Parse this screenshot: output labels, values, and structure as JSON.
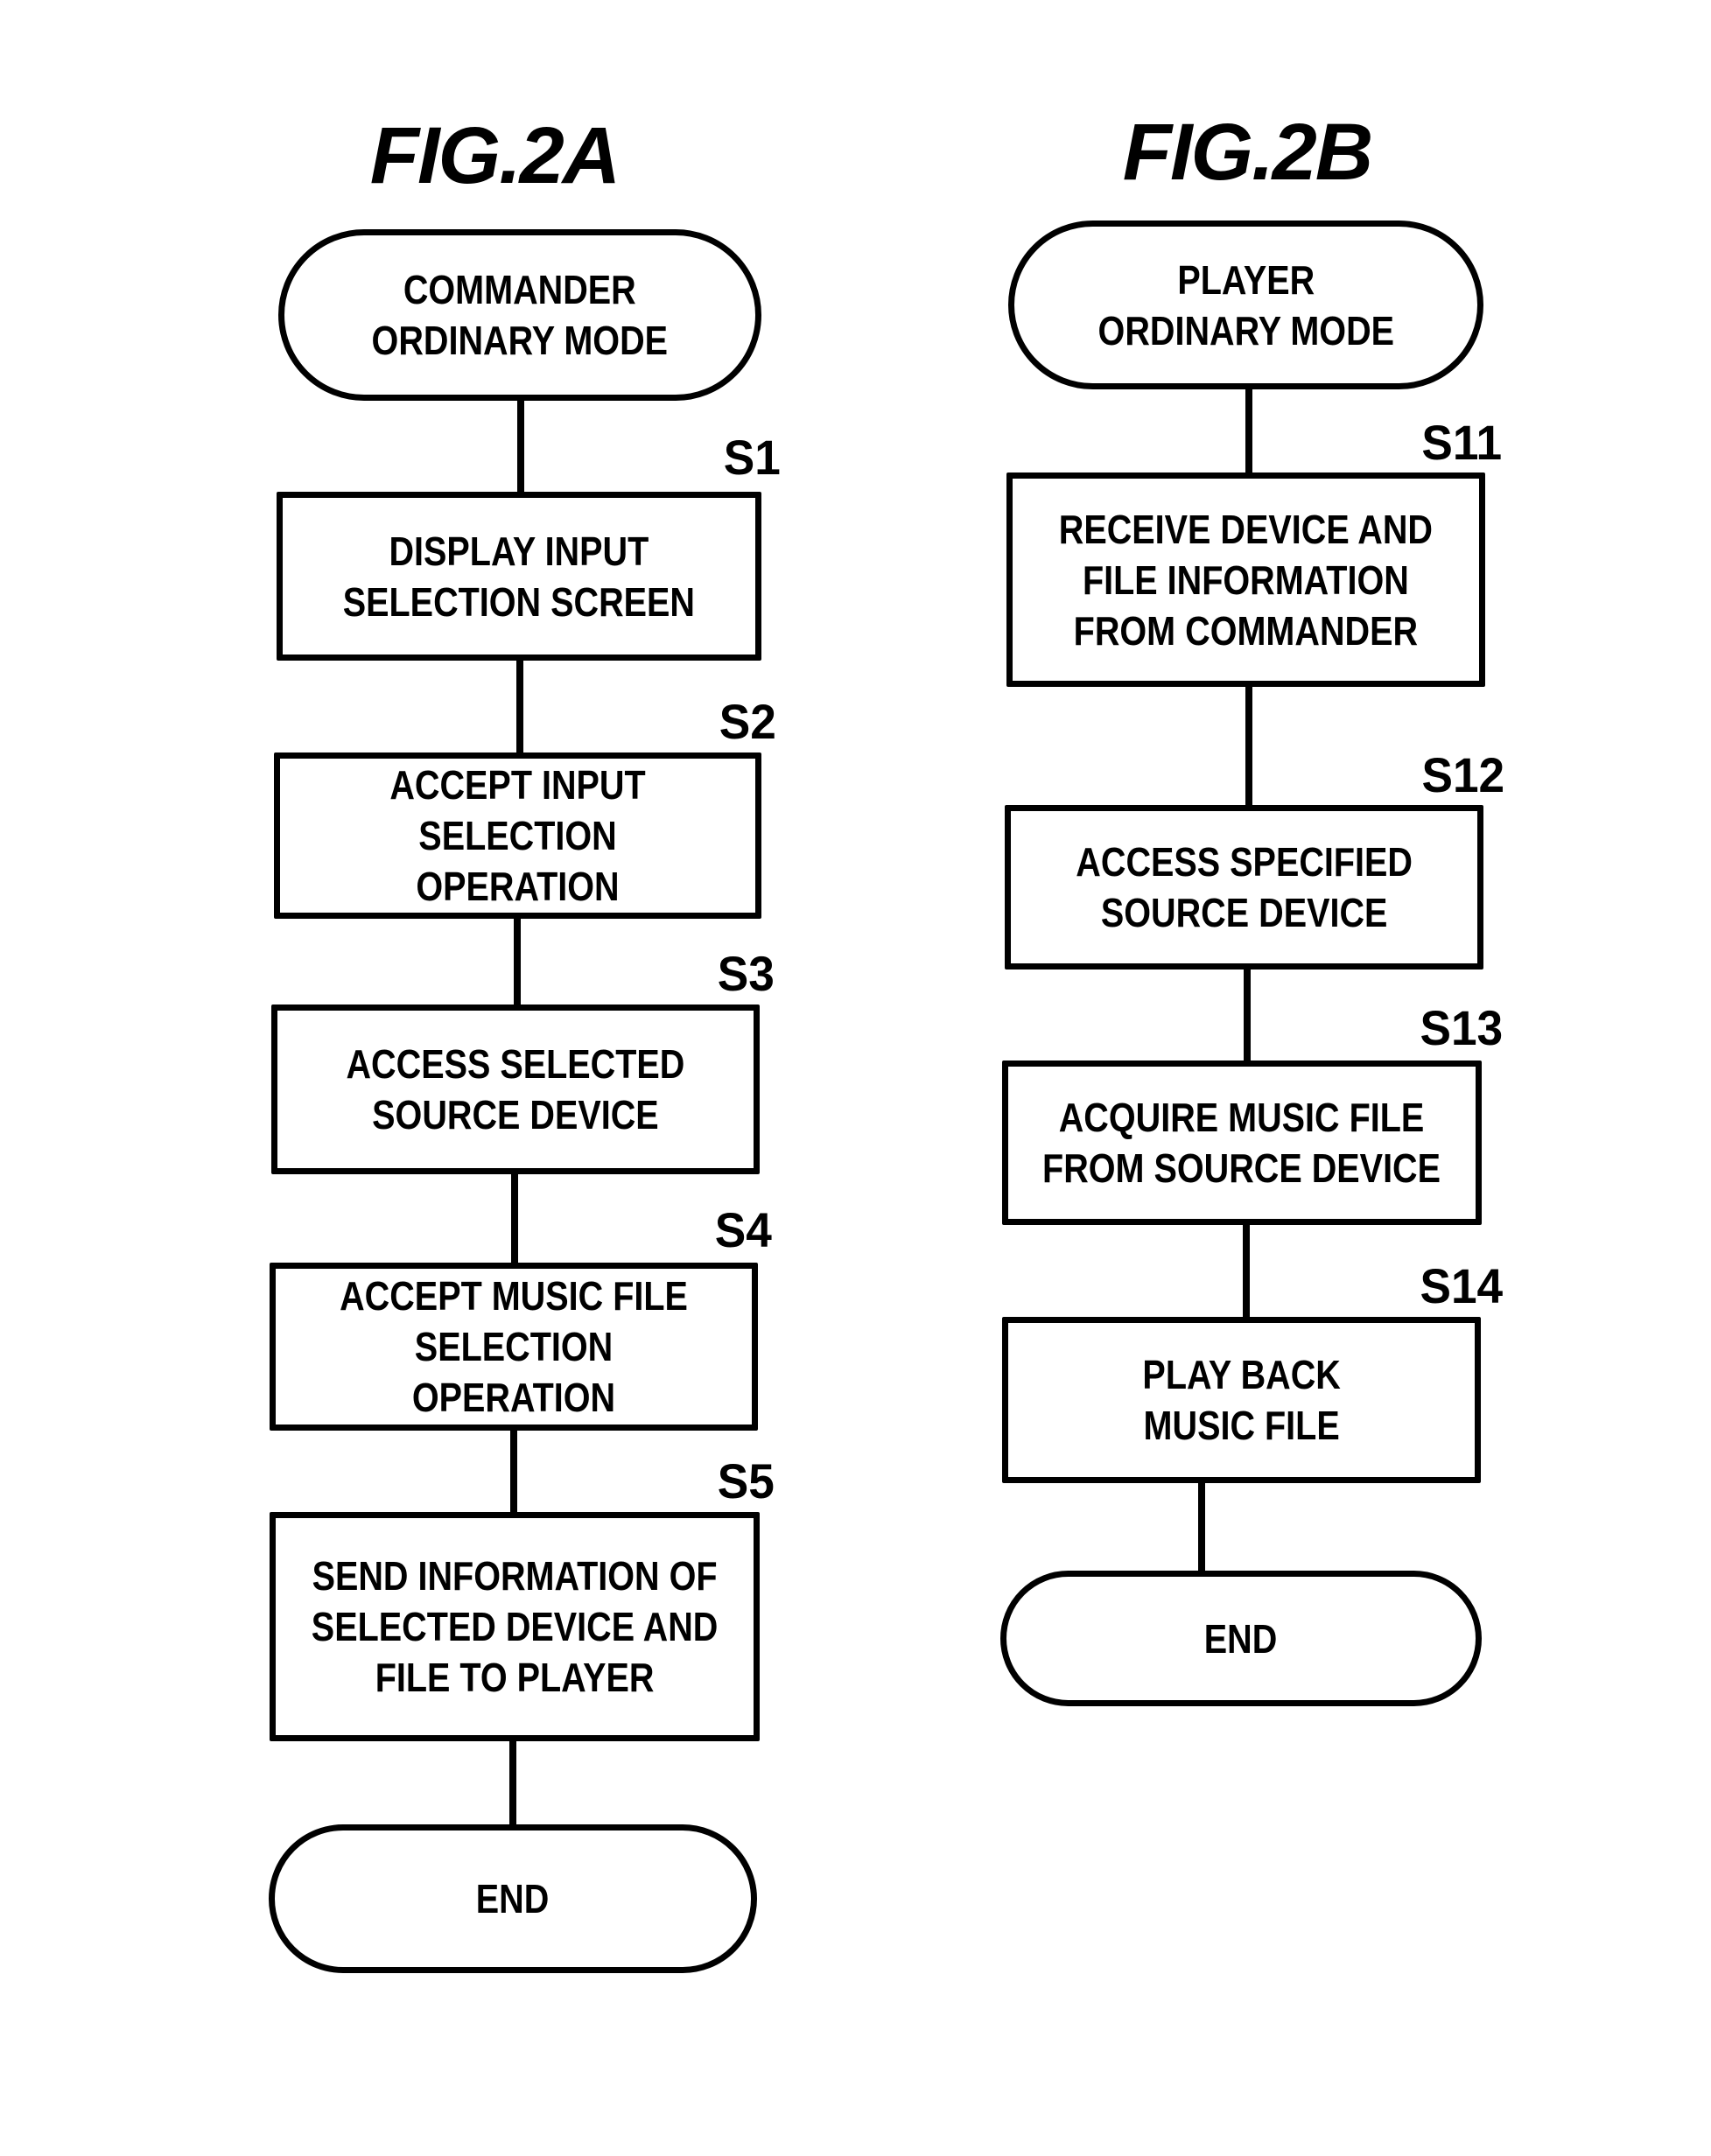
{
  "figures": [
    {
      "title": "FIG.2A",
      "start": "COMMANDER\nORDINARY MODE",
      "steps": [
        {
          "id": "S1",
          "text": "DISPLAY INPUT\nSELECTION SCREEN"
        },
        {
          "id": "S2",
          "text": "ACCEPT INPUT\nSELECTION OPERATION"
        },
        {
          "id": "S3",
          "text": "ACCESS SELECTED\nSOURCE DEVICE"
        },
        {
          "id": "S4",
          "text": "ACCEPT MUSIC FILE\nSELECTION OPERATION"
        },
        {
          "id": "S5",
          "text": "SEND INFORMATION OF\nSELECTED DEVICE AND\nFILE TO PLAYER"
        }
      ],
      "end": "END"
    },
    {
      "title": "FIG.2B",
      "start": "PLAYER\nORDINARY MODE",
      "steps": [
        {
          "id": "S11",
          "text": "RECEIVE DEVICE AND\nFILE INFORMATION\nFROM COMMANDER"
        },
        {
          "id": "S12",
          "text": "ACCESS SPECIFIED\nSOURCE DEVICE"
        },
        {
          "id": "S13",
          "text": "ACQUIRE MUSIC FILE\nFROM SOURCE DEVICE"
        },
        {
          "id": "S14",
          "text": "PLAY BACK\nMUSIC FILE"
        }
      ],
      "end": "END"
    }
  ]
}
